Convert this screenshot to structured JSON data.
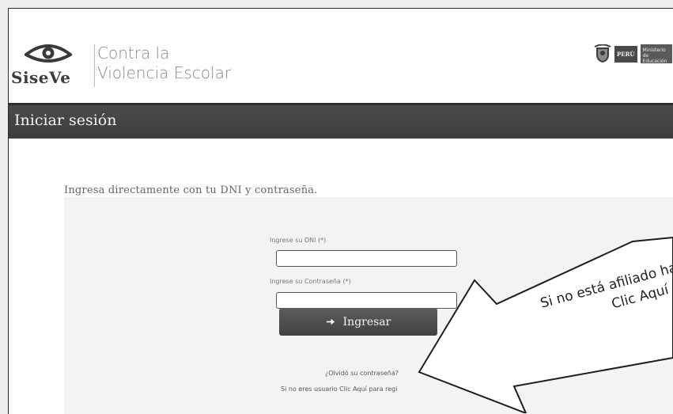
{
  "header": {
    "logo_brand": "SiseVe",
    "tagline_line1": "Contra la",
    "tagline_line2": "Violencia Escolar",
    "gov_country": "PERÚ",
    "gov_ministry": "Ministerio de Educación"
  },
  "titlebar": {
    "title": "Iniciar sesión"
  },
  "login": {
    "intro": "Ingresa directamente con tu DNI y contraseña.",
    "dni_label": "Ingrese su DNI (*)",
    "dni_value": "",
    "password_label": "Ingrese su Contraseña (*)",
    "password_value": "",
    "submit_label": "Ingresar",
    "forgot_link": "¿Olvidó su contraseña?",
    "register_text": "Si no eres usuario Clic Aquí para regi"
  },
  "callout": {
    "line1": "Si no está afiliado hac",
    "line2": "Clic Aquí"
  },
  "icons": [
    "eye-logo-icon",
    "peru-crest-icon",
    "sign-in-icon",
    "callout-arrow-icon"
  ]
}
